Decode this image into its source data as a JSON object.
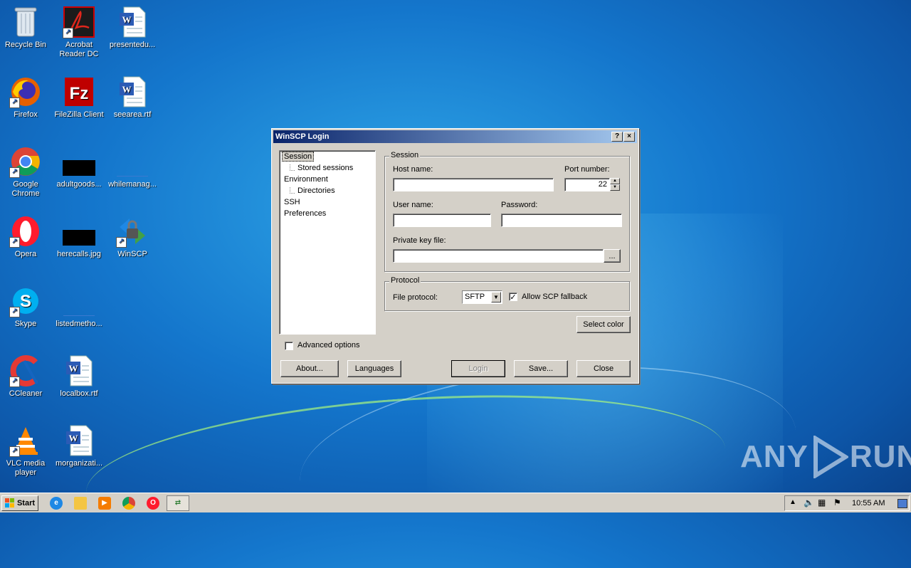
{
  "desktop": {
    "icons": [
      {
        "label": "Recycle Bin"
      },
      {
        "label": "Acrobat Reader DC"
      },
      {
        "label": "presentedu..."
      },
      {
        "label": "Firefox"
      },
      {
        "label": "FileZilla Client"
      },
      {
        "label": "seearea.rtf"
      },
      {
        "label": "Google Chrome"
      },
      {
        "label": "adultgoods..."
      },
      {
        "label": "whilemanag..."
      },
      {
        "label": "Opera"
      },
      {
        "label": "herecalls.jpg"
      },
      {
        "label": "WinSCP"
      },
      {
        "label": "Skype"
      },
      {
        "label": "listedmetho..."
      },
      {
        "label": "CCleaner"
      },
      {
        "label": "localbox.rtf"
      },
      {
        "label": "VLC media player"
      },
      {
        "label": "morganizati..."
      }
    ]
  },
  "dialog": {
    "title": "WinSCP Login",
    "help_glyph": "?",
    "close_glyph": "×",
    "tree": [
      "Session",
      "Stored sessions",
      "Environment",
      "Directories",
      "SSH",
      "Preferences"
    ],
    "session": {
      "group_label": "Session",
      "host_label": "Host name:",
      "host_value": "",
      "port_label": "Port number:",
      "port_value": "22",
      "user_label": "User name:",
      "user_value": "",
      "password_label": "Password:",
      "password_value": "",
      "key_label": "Private key file:",
      "key_value": "",
      "browse_label": "..."
    },
    "protocol": {
      "group_label": "Protocol",
      "file_protocol_label": "File protocol:",
      "file_protocol_value": "SFTP",
      "allow_scp_label": "Allow SCP fallback",
      "allow_scp_checked": true
    },
    "select_color_label": "Select color",
    "advanced_label": "Advanced options",
    "advanced_checked": false,
    "buttons": {
      "about": "About...",
      "languages": "Languages",
      "login": "Login",
      "save": "Save...",
      "close": "Close"
    }
  },
  "taskbar": {
    "start_label": "Start",
    "clock": "10:55 AM"
  },
  "watermark": {
    "left": "ANY",
    "right": "RUN"
  }
}
